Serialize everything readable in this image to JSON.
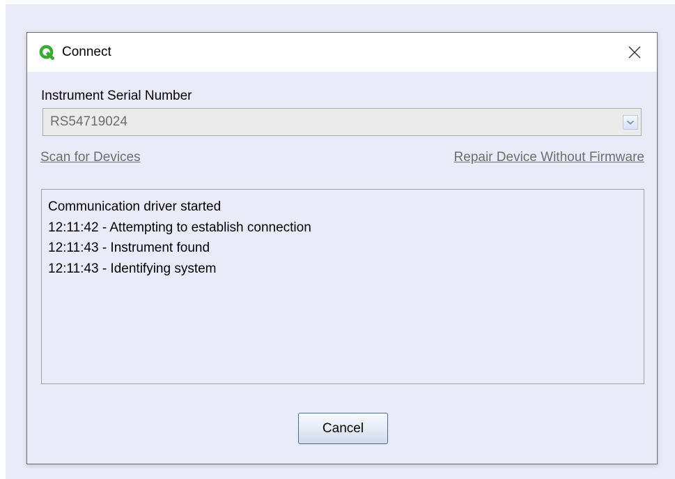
{
  "dialog": {
    "title": "Connect",
    "icon": "app-logo-icon",
    "close_icon": "close-icon",
    "accent_color": "#3aaa35"
  },
  "serial": {
    "label": "Instrument Serial Number",
    "value": "RS54719024",
    "arrow_icon": "chevron-down-icon"
  },
  "links": {
    "scan": "Scan for Devices",
    "repair": "Repair Device Without Firmware"
  },
  "log": {
    "lines": [
      "Communication driver started",
      "12:11:42 - Attempting to establish connection",
      "12:11:43 - Instrument found",
      "12:11:43 - Identifying system"
    ]
  },
  "buttons": {
    "cancel": "Cancel"
  }
}
